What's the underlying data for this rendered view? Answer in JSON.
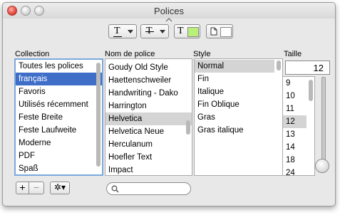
{
  "window": {
    "title": "Polices"
  },
  "toolbar": {
    "underline_glyph": "T",
    "strikethrough_glyph": "T",
    "text_color_glyph": "T",
    "text_color": "#b8f07a",
    "document_color": "#ffffff"
  },
  "headers": {
    "collection": "Collection",
    "font_name": "Nom de police",
    "style": "Style",
    "size": "Taille"
  },
  "collections": [
    "Toutes les polices",
    "français",
    "Favoris",
    "Utilisés récemment",
    "Feste Breite",
    "Feste Laufweite",
    "Moderne",
    "PDF",
    "Spaß"
  ],
  "fonts": [
    "Goudy Old Style",
    "Haettenschweiler",
    "Handwriting - Dako",
    "Harrington",
    "Helvetica",
    "Helvetica Neue",
    "Herculanum",
    "Hoefler Text",
    "Impact"
  ],
  "styles": [
    "Normal",
    "Fin",
    "Italique",
    "Fin Oblique",
    "Gras",
    "Gras italique"
  ],
  "size": {
    "value": "12",
    "options": [
      "9",
      "10",
      "11",
      "12",
      "13",
      "14",
      "18",
      "24"
    ]
  },
  "bottom": {
    "add_label": "+",
    "remove_label": "−",
    "gear_label": "✲▾"
  }
}
